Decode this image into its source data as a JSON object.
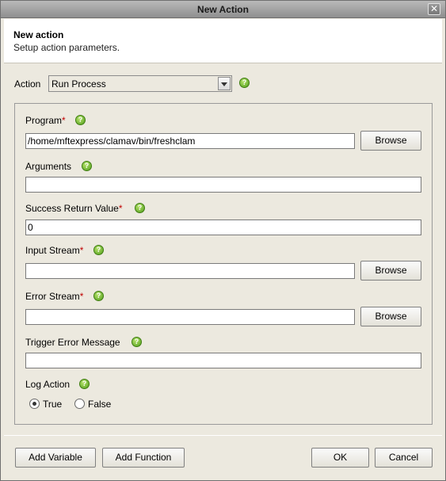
{
  "window": {
    "title": "New Action",
    "close_glyph": "✕"
  },
  "header": {
    "title": "New action",
    "subtitle": "Setup action parameters."
  },
  "action": {
    "label": "Action",
    "value": "Run Process"
  },
  "help_glyph": "?",
  "required_mark": "*",
  "fields": {
    "program": {
      "label": "Program",
      "value": "/home/mftexpress/clamav/bin/freshclam",
      "browse": "Browse"
    },
    "arguments": {
      "label": "Arguments",
      "value": ""
    },
    "success": {
      "label": "Success Return Value",
      "value": "0"
    },
    "input_stream": {
      "label": "Input Stream",
      "value": "",
      "browse": "Browse"
    },
    "error_stream": {
      "label": "Error Stream",
      "value": "",
      "browse": "Browse"
    },
    "trigger": {
      "label": "Trigger Error Message",
      "value": ""
    },
    "log_action": {
      "label": "Log Action",
      "true_label": "True",
      "false_label": "False",
      "selected": "True"
    }
  },
  "footer": {
    "add_variable": "Add Variable",
    "add_function": "Add Function",
    "ok": "OK",
    "cancel": "Cancel"
  }
}
